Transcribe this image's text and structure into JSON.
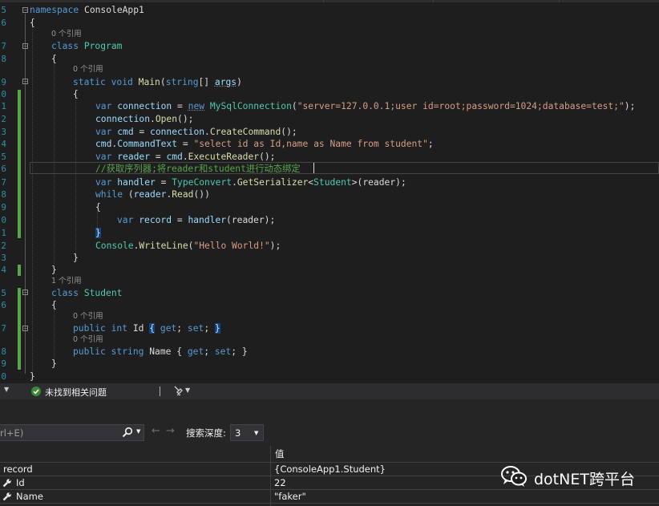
{
  "editor": {
    "line_numbers": [
      "5",
      "6",
      "",
      "7",
      "8",
      "",
      "9",
      "0",
      "1",
      "2",
      "3",
      "4",
      "5",
      "6",
      "7",
      "8",
      "9",
      "0",
      "1",
      "2",
      "3",
      "4",
      "",
      "5",
      "6",
      "",
      "7",
      "",
      "8",
      "9",
      "0"
    ],
    "code": {
      "l1_kw": "namespace",
      "l1_name": " ConsoleApp1",
      "l2": "{",
      "refs0a": "0 个引用",
      "l3_kw": "class",
      "l3_type": "Program",
      "l4": "{",
      "refs0b": "0 个引用",
      "l5_kw1": "static",
      "l5_kw2": "void",
      "l5_fn": "Main",
      "l5_p1": "(",
      "l5_kw3": "string",
      "l5_p2": "[] ",
      "l5_param": "args",
      "l5_p3": ")",
      "l6": "{",
      "l7_var": "var",
      "l7_name": "connection",
      "l7_eq": " = ",
      "l7_new": "new",
      "l7_type": "MySqlConnection",
      "l7_p1": "(",
      "l7_str": "\"server=127.0.0.1;user id=root;password=1024;database=test;\"",
      "l7_end": ");",
      "l8_obj": "connection",
      "l8_dot": ".",
      "l8_fn": "Open",
      "l8_end": "();",
      "l9_var": "var",
      "l9_name": "cmd",
      "l9_eq": " = ",
      "l9_obj": "connection",
      "l9_dot": ".",
      "l9_fn": "CreateCommand",
      "l9_end": "();",
      "l10_obj": "cmd",
      "l10_dot": ".",
      "l10_prop": "CommandText",
      "l10_eq": " = ",
      "l10_str": "\"select id as Id,name as Name from student\"",
      "l10_end": ";",
      "l11_var": "var",
      "l11_name": "reader",
      "l11_eq": " = ",
      "l11_obj": "cmd",
      "l11_dot": ".",
      "l11_fn": "ExecuteReader",
      "l11_end": "();",
      "l12_comment": "//获取序列器;将reader和student进行动态绑定",
      "l13_var": "var",
      "l13_name": "handler",
      "l13_eq": " = ",
      "l13_type": "TypeConvert",
      "l13_dot": ".",
      "l13_fn": "GetSerializer",
      "l13_lt": "<",
      "l13_gen": "Student",
      "l13_gt": ">",
      "l13_args": "(reader);",
      "l14_kw": "while",
      "l14_p1": " (",
      "l14_obj": "reader",
      "l14_dot": ".",
      "l14_fn": "Read",
      "l14_end": "())",
      "l15": "{",
      "l16_var": "var",
      "l16_name": "record",
      "l16_eq": " = ",
      "l16_fn": "handler",
      "l16_args": "(reader);",
      "l17": "}",
      "l18_type": "Console",
      "l18_dot": ".",
      "l18_fn": "WriteLine",
      "l18_p1": "(",
      "l18_str": "\"Hello World!\"",
      "l18_end": ");",
      "l19": "}",
      "l20": "}",
      "refs1": "1 个引用",
      "l21_kw": "class",
      "l21_type": "Student",
      "l22": "{",
      "refs0c": "0 个引用",
      "l23_kw1": "public",
      "l23_kw2": "int",
      "l23_name": "Id",
      "l23_ob": "{",
      "l23_get": "get",
      "l23_s1": "; ",
      "l23_set": "set",
      "l23_s2": "; ",
      "l23_cb": "}",
      "refs0d": "0 个引用",
      "l24_kw1": "public",
      "l24_kw2": "string",
      "l24_name": " Name { ",
      "l24_get": "get",
      "l24_s1": "; ",
      "l24_set": "set",
      "l24_s2": "; }",
      "l25": "}",
      "l26": "}"
    }
  },
  "statusbar": {
    "issues_text": "未找到相关问题",
    "status_color": "#57a64a"
  },
  "watch": {
    "search_placeholder": "rl+E)",
    "depth_label": "搜索深度:",
    "depth_value": "3",
    "col_value": "值",
    "rows": [
      {
        "name": "record",
        "value": "{ConsoleApp1.Student}"
      },
      {
        "name": "Id",
        "value": "22"
      },
      {
        "name": "Name",
        "value": "\"faker\""
      }
    ]
  },
  "watermark": {
    "text": "dotNET跨平台",
    "icon": "wechat-icon"
  }
}
